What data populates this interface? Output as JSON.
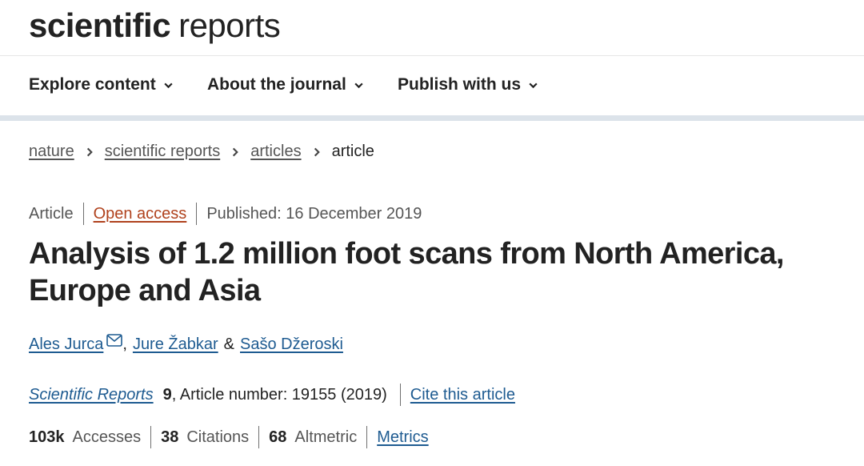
{
  "masthead": {
    "logo_bold": "scientific",
    "logo_light": "reports"
  },
  "nav": {
    "items": [
      {
        "label": "Explore content"
      },
      {
        "label": "About the journal"
      },
      {
        "label": "Publish with us"
      }
    ]
  },
  "breadcrumb": {
    "items": [
      "nature",
      "scientific reports",
      "articles"
    ],
    "current": "article"
  },
  "article": {
    "type": "Article",
    "access": "Open access",
    "published": "Published: 16 December 2019",
    "title": "Analysis of 1.2 million foot scans from North America, Europe and Asia",
    "authors": {
      "first": "Ales Jurca",
      "sep1": ",",
      "second": "Jure Žabkar",
      "sep2": "&",
      "third": "Sašo Džeroski"
    },
    "journal": {
      "name": "Scientific Reports",
      "volume": "9",
      "article_number": ", Article number: 19155 (2019)",
      "cite": "Cite this article"
    },
    "metrics": {
      "accesses_value": "103k",
      "accesses_label": "Accesses",
      "citations_value": "38",
      "citations_label": "Citations",
      "altmetric_value": "68",
      "altmetric_label": "Altmetric",
      "metrics_link": "Metrics"
    }
  },
  "colors": {
    "link": "#1e5b91",
    "open_access": "#b0421d",
    "nav_band": "#dce3ea"
  }
}
